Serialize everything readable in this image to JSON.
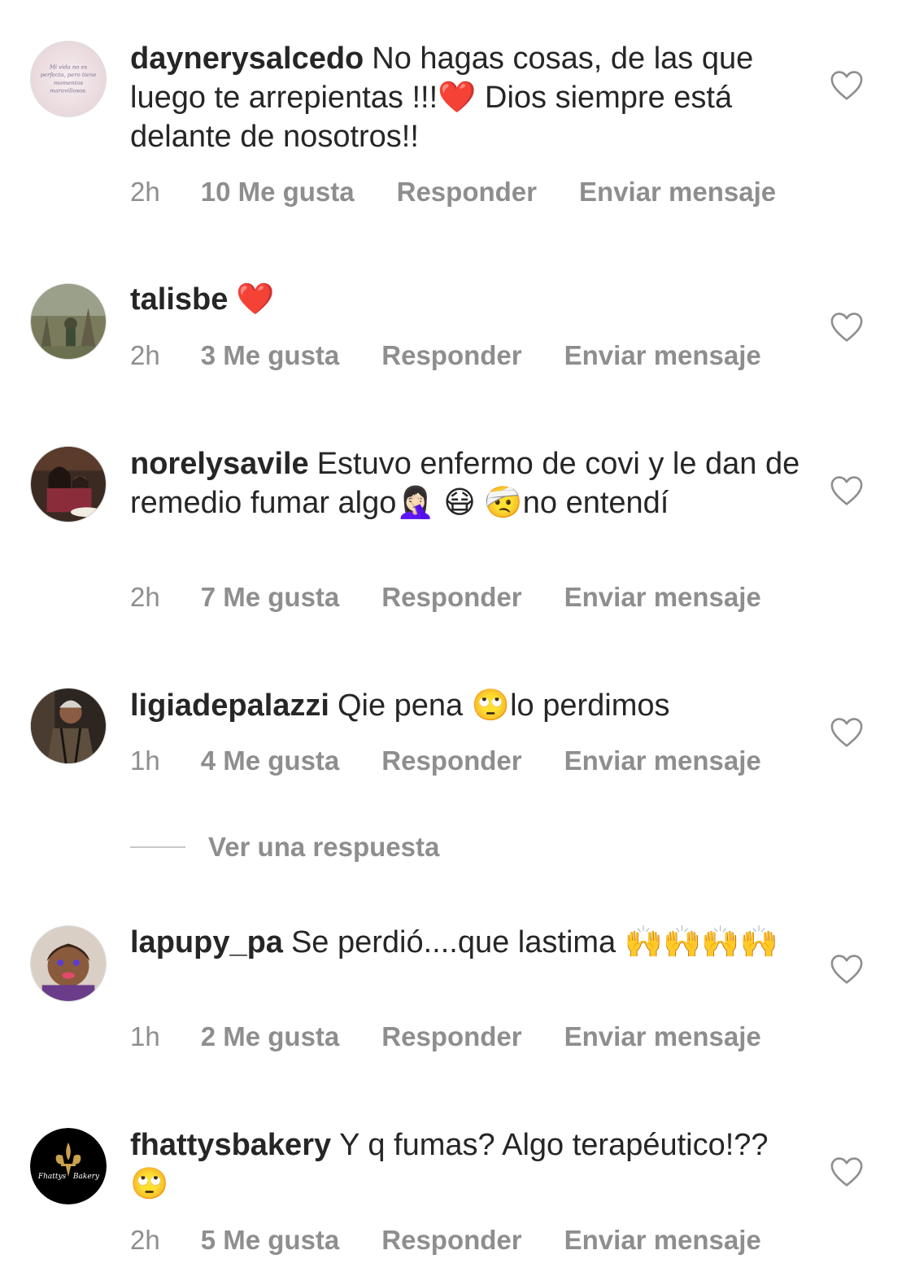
{
  "comments": [
    {
      "username": "daynerysalcedo",
      "text": "No hagas cosas, de las que luego te arrepientas !!!❤️ Dios siempre está delante de nosotros!!",
      "time": "2h",
      "likes": "10 Me gusta",
      "reply": "Responder",
      "message": "Enviar mensaje",
      "avatar_text": "Mi vida no es perfecta, pero tiene momentos maravillosos."
    },
    {
      "username": "talisbe",
      "text": "❤️",
      "time": "2h",
      "likes": "3 Me gusta",
      "reply": "Responder",
      "message": "Enviar mensaje"
    },
    {
      "username": "norelysavile",
      "text": "Estuvo enfermo de covi y le dan de remedio fumar algo🤦🏻‍♀️ 😷 🤕no entendí",
      "time": "2h",
      "likes": "7 Me gusta",
      "reply": "Responder",
      "message": "Enviar mensaje"
    },
    {
      "username": "ligiadepalazzi",
      "text": "Qie pena 🙄lo perdimos",
      "time": "1h",
      "likes": "4 Me gusta",
      "reply": "Responder",
      "message": "Enviar mensaje"
    },
    {
      "username": "lapupy_pa",
      "text": "Se perdió....que lastima 🙌🙌🙌🙌",
      "time": "1h",
      "likes": "2 Me gusta",
      "reply": "Responder",
      "message": "Enviar mensaje"
    },
    {
      "username": "fhattysbakery",
      "text": "Y q fumas? Algo terapéutico!?? 🙄",
      "time": "2h",
      "likes": "5 Me gusta",
      "reply": "Responder",
      "message": "Enviar mensaje",
      "avatar_text": "Fhattys Bakery"
    }
  ],
  "view_replies": "Ver una respuesta",
  "colors": {
    "text": "#262626",
    "secondary": "#8e8e8e",
    "divider": "#c7c7c7"
  }
}
